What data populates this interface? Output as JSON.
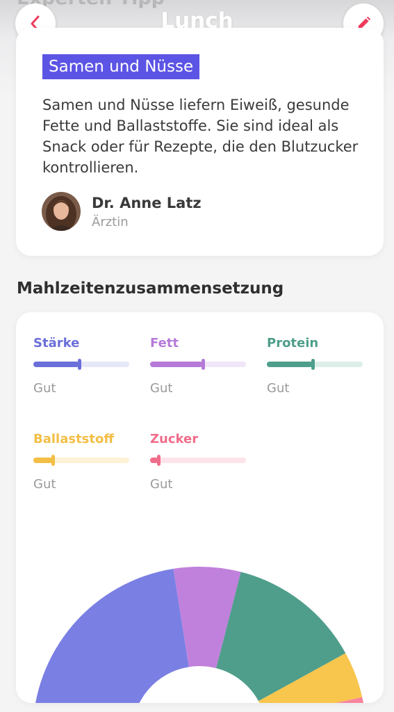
{
  "header": {
    "section_title": "Experten Tipp",
    "screen_title": "Lunch",
    "back_icon": "chevron-left-icon",
    "edit_icon": "pencil-icon",
    "accent_color": "#ef3b5c"
  },
  "tip": {
    "tag": "Samen und Nüsse",
    "tag_color": "#5b54e4",
    "text": "Samen und Nüsse liefern Eiweiß, gesunde Fette und Ballaststoffe. Sie sind ideal als Snack oder für Rezepte, die den Blutzucker kontrollieren.",
    "author": {
      "name": "Dr. Anne Latz",
      "role": "Ärztin"
    }
  },
  "composition": {
    "heading": "Mahlzeitenzusammensetzung",
    "metrics": [
      {
        "name": "Stärke",
        "rating": "Gut",
        "color": "#6b6fd9",
        "track": "#e6e7f8",
        "level": 0.48
      },
      {
        "name": "Fett",
        "rating": "Gut",
        "color": "#b57ad8",
        "track": "#f1e6f8",
        "level": 0.55
      },
      {
        "name": "Protein",
        "rating": "Gut",
        "color": "#4f9e8b",
        "track": "#dcefe9",
        "level": 0.48
      },
      {
        "name": "Ballaststoff",
        "rating": "Gut",
        "color": "#f2be45",
        "track": "#fdf1d6",
        "level": 0.2
      },
      {
        "name": "Zucker",
        "rating": "Gut",
        "color": "#ef6d8a",
        "track": "#fde4ea",
        "level": 0.09
      }
    ]
  },
  "chart_data": {
    "type": "pie",
    "labels": [
      "Stärke",
      "Fett",
      "Protein",
      "Ballaststoff",
      "Zucker"
    ],
    "values": [
      45,
      13,
      26,
      9,
      7
    ],
    "colors": [
      "#7a7fe4",
      "#c081dc",
      "#4f9e8b",
      "#f8c54d",
      "#f8849e"
    ],
    "title": ""
  }
}
